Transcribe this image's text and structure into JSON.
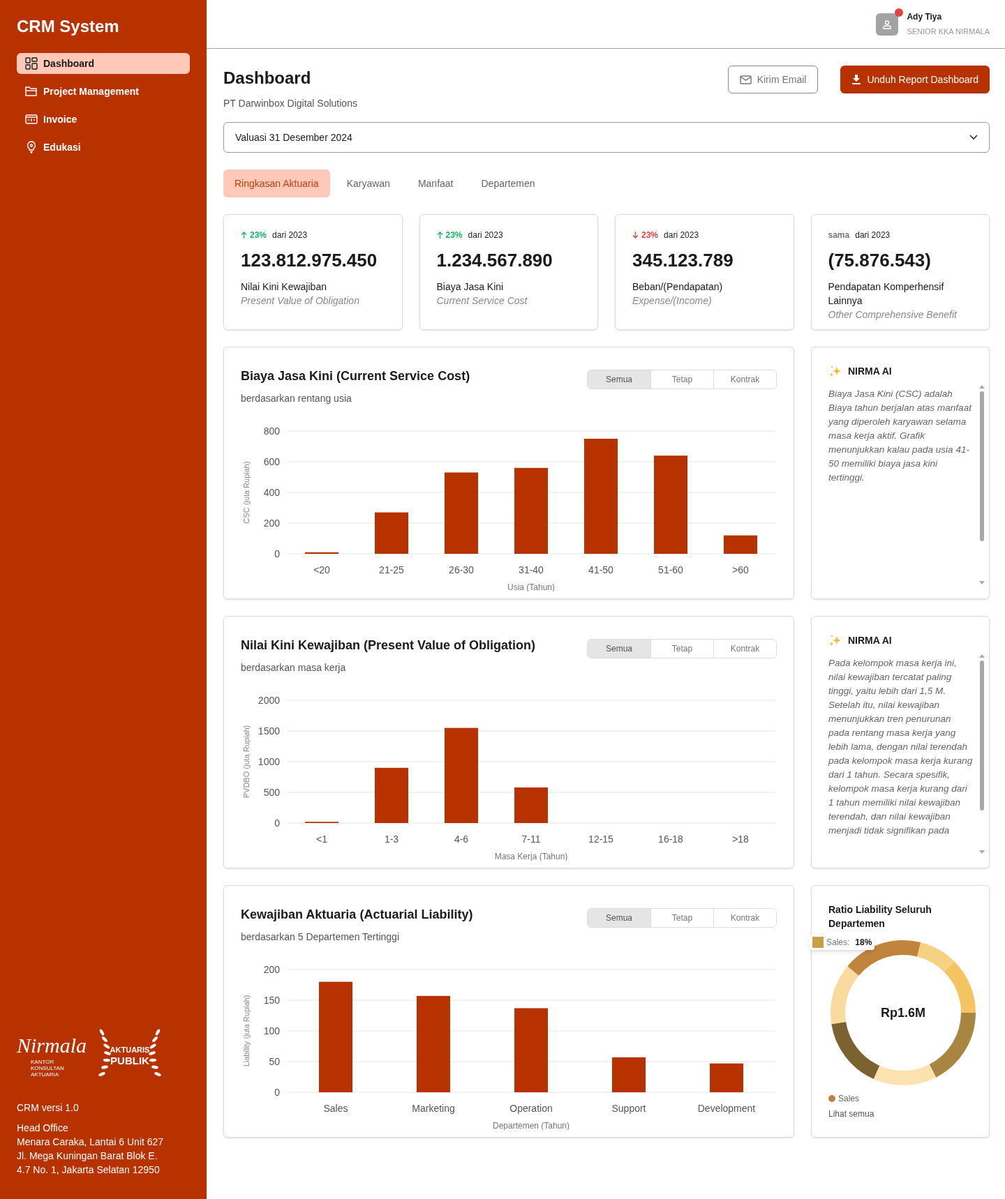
{
  "sidebar": {
    "title": "CRM System",
    "items": [
      {
        "label": "Dashboard",
        "selected": true
      },
      {
        "label": "Project Management",
        "selected": false
      },
      {
        "label": "Invoice",
        "selected": false
      },
      {
        "label": "Edukasi",
        "selected": false
      }
    ],
    "logo": {
      "script": "Nirmala",
      "caption": "KANTOR KONSULTAN AKTUARIA",
      "badge": [
        "AKTUARIS",
        "PUBLIK"
      ]
    },
    "version": "CRM versi 1.0",
    "office": {
      "title": "Head Office",
      "lines": [
        "Menara Caraka, Lantai 6 Unit 627",
        "Jl. Mega Kuningan Barat Blok E.",
        "4.7 No. 1, Jakarta Selatan 12950"
      ]
    }
  },
  "user": {
    "name": "Ady Tiya",
    "role": "SENIOR KKA NIRMALA",
    "notification": true
  },
  "page": {
    "title": "Dashboard",
    "subtitle": "PT Darwinbox Digital Solutions"
  },
  "buttons": [
    {
      "label": "Kirim Email",
      "kind": "outline"
    },
    {
      "label": "Unduh Report Dashboard",
      "kind": "primary"
    }
  ],
  "valuation": {
    "value": "Valuasi 31 Desember 2024"
  },
  "tabs": [
    {
      "label": "Ringkasan Aktuaria",
      "selected": true
    },
    {
      "label": "Karyawan",
      "selected": false
    },
    {
      "label": "Manfaat",
      "selected": false
    },
    {
      "label": "Departemen",
      "selected": false
    }
  ],
  "stats": [
    {
      "kind": "up",
      "change": "23%",
      "since": "dari 2023",
      "value": "123.812.975.450",
      "label": "Nilai Kini Kewajiban",
      "sublabel": "Present Value of Obligation"
    },
    {
      "kind": "up",
      "change": "23%",
      "since": "dari 2023",
      "value": "1.234.567.890",
      "label": "Biaya Jasa Kini",
      "sublabel": "Current Service Cost"
    },
    {
      "kind": "down",
      "change": "23%",
      "since": "dari 2023",
      "value": "345.123.789",
      "label": "Beban/(Pendapatan)",
      "sublabel": "Expense/(Income)"
    },
    {
      "kind": "same",
      "change": "sama",
      "since": "dari 2023",
      "value": "(75.876.543)",
      "label": "Pendapatan Komperhensif Lainnya",
      "sublabel": "Other Comprehensive Benefit"
    }
  ],
  "sections": [
    {
      "title": "Biaya Jasa Kini (Current Service Cost)",
      "subtitle": "berdasarkan rentang usia",
      "filters": [
        {
          "label": "Semua",
          "selected": true
        },
        {
          "label": "Tetap",
          "selected": false
        },
        {
          "label": "Kontrak",
          "selected": false
        }
      ],
      "chart_data": {
        "type": "bar",
        "xlabel": "Usia (Tahun)",
        "ylabel": "CSC (juta Rupiah)",
        "categories": [
          "<20",
          "21-25",
          "26-30",
          "31-40",
          "41-50",
          "51-60",
          ">60"
        ],
        "values": [
          10,
          270,
          530,
          560,
          750,
          640,
          120
        ],
        "color": "#b83200",
        "grid": true,
        "ylim": [
          0,
          800
        ],
        "yticks": [
          0,
          200,
          400,
          600,
          800
        ]
      },
      "side": {
        "kind": "insight",
        "title": "NIRMA AI",
        "text": "Biaya Jasa Kini (CSC) adalah Biaya tahun berjalan atas manfaat yang diperoleh karyawan selama masa kerja aktif. Grafik menunjukkan kalau pada usia 41-50 memiliki biaya jasa kini tertinggi."
      }
    },
    {
      "title": "Nilai Kini Kewajiban (Present Value of Obligation)",
      "subtitle": "berdasarkan masa kerja",
      "filters": [
        {
          "label": "Semua",
          "selected": true
        },
        {
          "label": "Tetap",
          "selected": false
        },
        {
          "label": "Kontrak",
          "selected": false
        }
      ],
      "chart_data": {
        "type": "bar",
        "xlabel": "Masa Kerja (Tahun)",
        "ylabel": "PVDBO (juta Rupiah)",
        "categories": [
          "<1",
          "1-3",
          "4-6",
          "7-11",
          "12-15",
          "16-18",
          ">18"
        ],
        "values": [
          20,
          900,
          1550,
          580,
          0,
          0,
          0
        ],
        "color": "#b83200",
        "grid": true,
        "ylim": [
          0,
          2000
        ],
        "yticks": [
          0,
          500,
          1000,
          1500,
          2000
        ]
      },
      "side": {
        "kind": "insight",
        "title": "NIRMA AI",
        "text": "Pada kelompok masa kerja ini, nilai kewajiban tercatat paling tinggi, yaitu lebih dari 1,5 M. Setelah itu, nilai kewajiban menunjukkan tren penurunan pada rentang masa kerja yang lebih lama, dengan nilai terendah pada kelompok masa kerja kurang dari 1 tahun. Secara spesifik, kelompok masa kerja kurang dari 1 tahun memiliki nilai kewajiban terendah, dan nilai kewajiban menjadi tidak signifikan pada"
      }
    },
    {
      "title": "Kewajiban Aktuaria (Actuarial Liability)",
      "subtitle": "berdasarkan 5 Departemen Tertinggi",
      "filters": [
        {
          "label": "Semua",
          "selected": true
        },
        {
          "label": "Tetap",
          "selected": false
        },
        {
          "label": "Kontrak",
          "selected": false
        }
      ],
      "chart_data": {
        "type": "bar",
        "xlabel": "Departemen (Tahun)",
        "ylabel": "Liability (juta Rupiah)",
        "categories": [
          "Sales",
          "Marketing",
          "Operation",
          "Support",
          "Development"
        ],
        "values": [
          180,
          157,
          137,
          57,
          47
        ],
        "color": "#b83200",
        "grid": true,
        "ylim": [
          0,
          200
        ],
        "yticks": [
          0,
          50,
          100,
          150,
          200
        ]
      },
      "side": {
        "kind": "ratio",
        "title": "Ratio Liability Seluruh Departemen",
        "total": "Rp1.6M",
        "tooltip": {
          "label": "Sales:",
          "value": "18%"
        },
        "legend": [
          {
            "label": "Sales",
            "color": "#c0843c"
          }
        ],
        "link": "Lihat semua"
      }
    }
  ]
}
